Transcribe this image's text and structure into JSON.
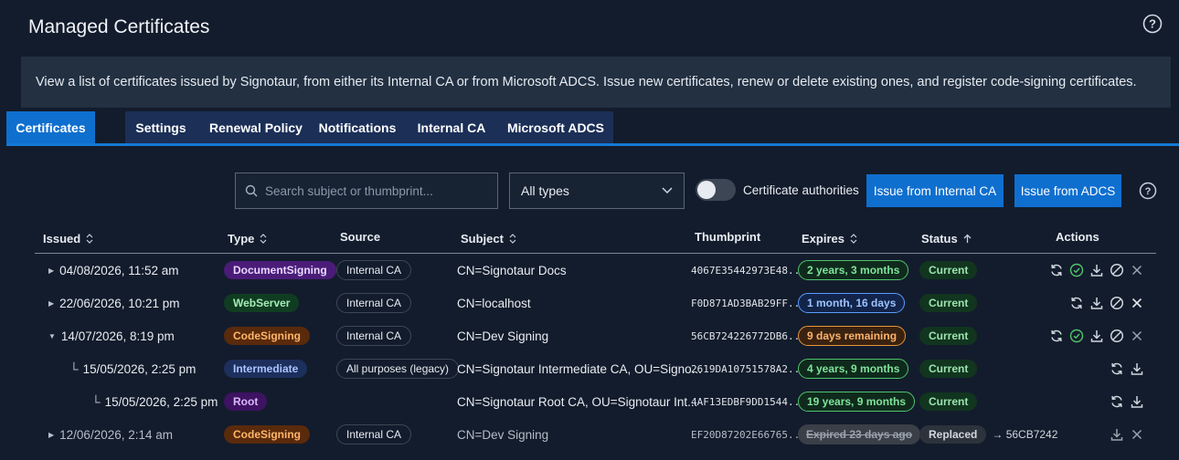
{
  "page": {
    "title": "Managed Certificates"
  },
  "banner": {
    "text": "View a list of certificates issued by Signotaur, from either its Internal CA or from Microsoft ADCS. Issue new certificates, renew or delete existing ones, and register code-signing certificates."
  },
  "tabs": [
    {
      "label": "Certificates",
      "active": true
    },
    {
      "label": "Settings"
    },
    {
      "label": "Renewal Policy"
    },
    {
      "label": "Notifications"
    },
    {
      "label": "Internal CA"
    },
    {
      "label": "Microsoft ADCS"
    }
  ],
  "toolbar": {
    "search_placeholder": "Search subject or thumbprint...",
    "type_filter": "All types",
    "toggle_label": "Certificate authorities",
    "issue_internal_label": "Issue from Internal CA",
    "issue_adcs_label": "Issue from ADCS"
  },
  "table": {
    "headers": {
      "issued": "Issued",
      "type": "Type",
      "source": "Source",
      "subject": "Subject",
      "thumbprint": "Thumbprint",
      "expires": "Expires",
      "status": "Status",
      "actions": "Actions"
    },
    "rows": [
      {
        "issued": "04/08/2026, 11:52 am",
        "type": "DocumentSigning",
        "source": "Internal CA",
        "subject": "CN=Signotaur Docs",
        "thumbprint": "4067E35442973E48...",
        "expires": "2 years, 3 months",
        "status": "Current"
      },
      {
        "issued": "22/06/2026, 10:21 pm",
        "type": "WebServer",
        "source": "Internal CA",
        "subject": "CN=localhost",
        "thumbprint": "F0D871AD3BAB29FF...",
        "expires": "1 month, 16 days",
        "status": "Current"
      },
      {
        "issued": "14/07/2026, 8:19 pm",
        "type": "CodeSigning",
        "source": "Internal CA",
        "subject": "CN=Dev Signing",
        "thumbprint": "56CB724226772DB6...",
        "expires": "9 days remaining",
        "status": "Current"
      },
      {
        "issued": "15/05/2026, 2:25 pm",
        "type": "Intermediate",
        "source": "All purposes (legacy)",
        "subject": "CN=Signotaur Intermediate CA, OU=Signo...",
        "thumbprint": "2619DA10751578A2...",
        "expires": "4 years, 9 months",
        "status": "Current"
      },
      {
        "issued": "15/05/2026, 2:25 pm",
        "type": "Root",
        "source": "",
        "subject": "CN=Signotaur Root CA, OU=Signotaur Int...",
        "thumbprint": "4AF13EDBF9DD1544...",
        "expires": "19 years, 9 months",
        "status": "Current"
      },
      {
        "issued": "12/06/2026, 2:14 am",
        "type": "CodeSigning",
        "source": "Internal CA",
        "subject": "CN=Dev Signing",
        "thumbprint": "EF20D87202E66765...",
        "expires": "Expired 23 days ago",
        "status": "Replaced",
        "replaced_by": "→ 56CB7242"
      }
    ]
  },
  "colors": {
    "accent": "#0f6fcf",
    "current_bg": "#123a24",
    "current_fg": "#9be3ad",
    "green": "#5fd07a",
    "blue": "#6aa9ff",
    "orange": "#f2a33a"
  },
  "icons": [
    "help-icon",
    "search-icon",
    "chevron-down-icon",
    "renew-icon",
    "approve-icon",
    "download-icon",
    "revoke-icon",
    "delete-icon",
    "sort-icon"
  ]
}
